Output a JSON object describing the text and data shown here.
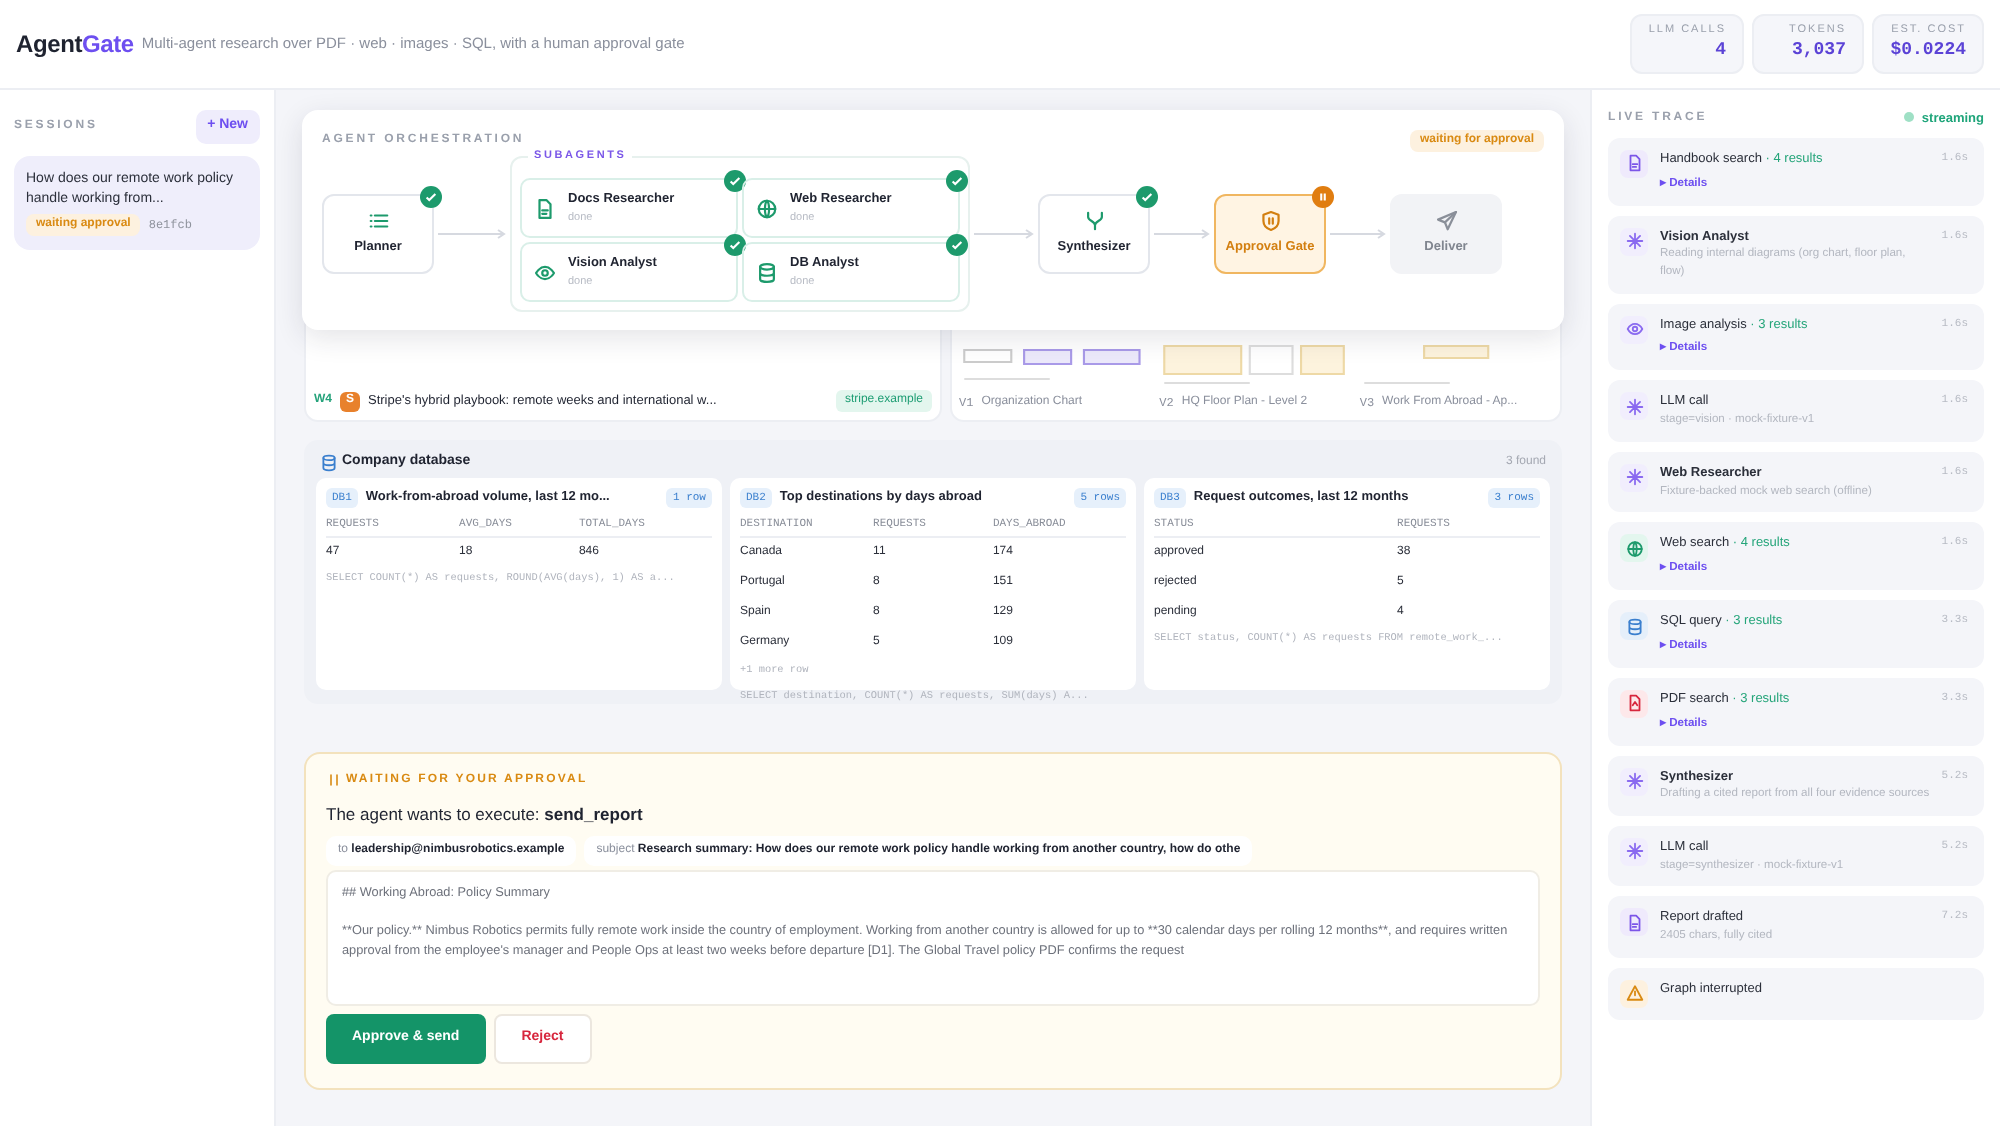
{
  "header": {
    "brand_dark": "Agent",
    "brand_accent": "Gate",
    "tagline": "Multi-agent research over PDF · web · images · SQL, with a human approval gate",
    "stats": [
      {
        "label": "LLM CALLS",
        "value": "4"
      },
      {
        "label": "TOKENS",
        "value": "3,037"
      },
      {
        "label": "EST. COST",
        "value": "$0.0224"
      }
    ]
  },
  "sessions": {
    "title": "SESSIONS",
    "new_button": "+ New",
    "items": [
      {
        "question": "How does our remote work policy handle working from...",
        "status": "waiting approval",
        "id": "8e1fcb",
        "selected": true
      }
    ]
  },
  "orchestration": {
    "title": "AGENT ORCHESTRATION",
    "status": "waiting for approval",
    "subagents_label": "SUBAGENTS",
    "planner": {
      "label": "Planner",
      "kind": "list",
      "done": true
    },
    "subagents": [
      {
        "label": "Docs Researcher",
        "sub": "done",
        "kind": "doc",
        "done": true
      },
      {
        "label": "Web Researcher",
        "sub": "done",
        "kind": "globe",
        "done": true
      },
      {
        "label": "Vision Analyst",
        "sub": "done",
        "kind": "eye",
        "done": true
      },
      {
        "label": "DB Analyst",
        "sub": "done",
        "kind": "db",
        "done": true
      }
    ],
    "after": [
      {
        "label": "Synthesizer",
        "kind": "fork",
        "done": true
      },
      {
        "label": "Approval Gate",
        "kind": "shield",
        "done": false,
        "awaiting": true
      },
      {
        "label": "Deliver",
        "kind": "send",
        "done": false,
        "awaiting": false
      }
    ]
  },
  "web_sources": [
    {
      "tag": "W4",
      "letter": "S",
      "title": "Stripe's hybrid playbook: remote weeks and international w...",
      "domain": "stripe.example"
    }
  ],
  "images": [
    {
      "tag": "V1",
      "caption": "Organization Chart",
      "kind": "picture"
    },
    {
      "tag": "V2",
      "caption": "HQ Floor Plan - Level 2",
      "kind": "picture"
    },
    {
      "tag": "V3",
      "caption": "Work From Abroad - Ap...",
      "kind": "picture"
    }
  ],
  "database": {
    "title": "Company database",
    "count": "3 found",
    "tables": [
      {
        "tag": "DB1",
        "title": "Work-from-abroad volume, last 12 mo...",
        "rows_badge": "1 row",
        "columns": [
          "REQUESTS",
          "AVG_DAYS",
          "TOTAL_DAYS"
        ],
        "rows": [
          [
            "47",
            "18",
            "846"
          ]
        ],
        "sql": "SELECT COUNT(*) AS requests, ROUND(AVG(days), 1) AS a..."
      },
      {
        "tag": "DB2",
        "title": "Top destinations by days abroad",
        "rows_badge": "5 rows",
        "columns": [
          "DESTINATION",
          "REQUESTS",
          "DAYS_ABROAD"
        ],
        "rows": [
          [
            "Canada",
            "11",
            "174"
          ],
          [
            "Portugal",
            "8",
            "151"
          ],
          [
            "Spain",
            "8",
            "129"
          ],
          [
            "Germany",
            "5",
            "109"
          ]
        ],
        "more": "+1 more row",
        "sql": "SELECT destination, COUNT(*) AS requests, SUM(days) A..."
      },
      {
        "tag": "DB3",
        "title": "Request outcomes, last 12 months",
        "rows_badge": "3 rows",
        "columns": [
          "STATUS",
          "REQUESTS"
        ],
        "rows": [
          [
            "approved",
            "38"
          ],
          [
            "rejected",
            "5"
          ],
          [
            "pending",
            "4"
          ]
        ],
        "sql": "SELECT status, COUNT(*) AS requests FROM remote_work_..."
      }
    ]
  },
  "approval": {
    "title": "WAITING FOR YOUR APPROVAL",
    "prompt": "The agent wants to execute: **send_report**",
    "to_label": "to",
    "to": "leadership@nimbusrobotics.example",
    "subject_label": "subject",
    "subject": "Research summary: How does our remote work policy handle working from another country, how do othe",
    "report": [
      "## Working Abroad: Policy Summary",
      "**Our policy.** Nimbus Robotics permits fully remote work inside the country of employment. Working from another country is allowed for up to **30 calendar days per rolling 12 months**, and requires written approval from the employee's manager and People Ops at least two weeks before departure [D1]. The Global Travel policy PDF confirms the request"
    ],
    "approve": "Approve & send",
    "reject": "Reject"
  },
  "trace": {
    "title": "LIVE TRACE",
    "status": "streaming",
    "items": [
      {
        "kind": "doc",
        "title": "Handbook search",
        "count": "· 4 results",
        "details": "▸ Details",
        "time": "1.6s"
      },
      {
        "kind": "spark",
        "title": "Vision Analyst",
        "bold": true,
        "sub": "Reading internal diagrams (org chart, floor plan, flow)",
        "time": "1.6s"
      },
      {
        "kind": "eye",
        "title": "Image analysis",
        "count": "· 3 results",
        "details": "▸ Details",
        "time": "1.6s"
      },
      {
        "kind": "spark",
        "title": "LLM call",
        "sub": "stage=vision · mock-fixture-v1",
        "time": "1.6s"
      },
      {
        "kind": "spark",
        "title": "Web Researcher",
        "bold": true,
        "sub": "Fixture-backed mock web search (offline)",
        "time": "1.6s"
      },
      {
        "kind": "globe",
        "title": "Web search",
        "count": "· 4 results",
        "details": "▸ Details",
        "time": "1.6s"
      },
      {
        "kind": "db",
        "title": "SQL query",
        "count": "· 3 results",
        "details": "▸ Details",
        "time": "3.3s"
      },
      {
        "kind": "pdf",
        "title": "PDF search",
        "count": "· 3 results",
        "details": "▸ Details",
        "time": "3.3s"
      },
      {
        "kind": "spark",
        "title": "Synthesizer",
        "bold": true,
        "sub": "Drafting a cited report from all four evidence sources",
        "time": "5.2s"
      },
      {
        "kind": "spark",
        "title": "LLM call",
        "sub": "stage=synthesizer · mock-fixture-v1",
        "time": "5.2s"
      },
      {
        "kind": "doc",
        "title": "Report drafted",
        "sub": "2405 chars, fully cited",
        "time": "7.2s"
      },
      {
        "kind": "warn",
        "title": "Graph interrupted"
      }
    ]
  }
}
